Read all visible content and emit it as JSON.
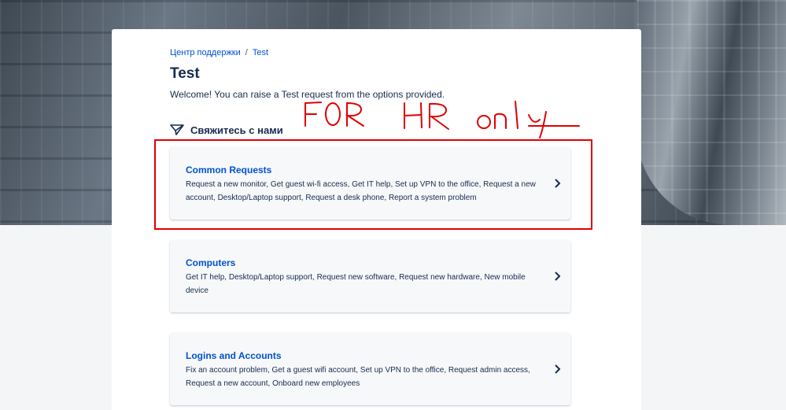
{
  "breadcrumb": {
    "home": "Центр поддержки",
    "separator": "/",
    "current": "Test"
  },
  "page": {
    "title": "Test",
    "welcome": "Welcome! You can raise a Test request from the options provided."
  },
  "contact": {
    "label": "Свяжитесь с нами",
    "icon": "send-icon"
  },
  "requests": [
    {
      "title": "Common Requests",
      "description": "Request a new monitor, Get guest wi-fi access, Get IT help, Set up VPN to the office, Request a new account, Desktop/Laptop support, Request a desk phone, Report a system problem"
    },
    {
      "title": "Computers",
      "description": "Get IT help, Desktop/Laptop support, Request new software, Request new hardware, New mobile device"
    },
    {
      "title": "Logins and Accounts",
      "description": "Fix an account problem, Get a guest wifi account, Set up VPN to the office, Request admin access, Request a new account, Onboard new employees"
    }
  ],
  "annotation": {
    "text": "FOR HR only",
    "color": "#e00000"
  },
  "colors": {
    "link": "#0052cc",
    "text": "#172b4d",
    "card_bg": "#f7f8fa"
  }
}
